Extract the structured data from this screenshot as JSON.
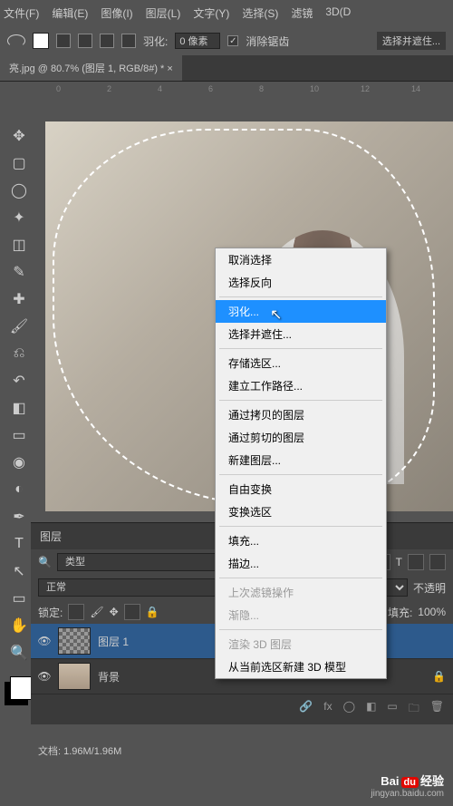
{
  "menubar": [
    "文件(F)",
    "编辑(E)",
    "图像(I)",
    "图层(L)",
    "文字(Y)",
    "选择(S)",
    "滤镜",
    "3D(D"
  ],
  "options": {
    "feather_label": "羽化:",
    "feather_value": "0 像素",
    "antialias": "消除锯齿",
    "selmask": "选择并遮住..."
  },
  "doc": {
    "tab": "亮.jpg @ 80.7% (图层 1, RGB/8#) *"
  },
  "ruler": [
    "0",
    "2",
    "4",
    "6",
    "8",
    "10",
    "12",
    "14"
  ],
  "tools": {
    "move": "✥",
    "marquee": "▢",
    "lasso": "◯",
    "wand": "✦",
    "crop": "◫",
    "eyedrop": "✎",
    "heal": "✚",
    "brush": "🖌",
    "stamp": "⎌",
    "history": "↶",
    "eraser": "◧",
    "gradient": "▭",
    "blur": "◉",
    "dodge": "◐",
    "pen": "✒",
    "type": "T",
    "path": "↖",
    "shape": "▭",
    "hand": "✋",
    "zoom": "🔍"
  },
  "context": {
    "items": [
      {
        "label": "取消选择",
        "enabled": true
      },
      {
        "label": "选择反向",
        "enabled": true
      },
      {
        "sep": true
      },
      {
        "label": "羽化...",
        "enabled": true,
        "hl": true
      },
      {
        "label": "选择并遮住...",
        "enabled": true
      },
      {
        "sep": true
      },
      {
        "label": "存储选区...",
        "enabled": true
      },
      {
        "label": "建立工作路径...",
        "enabled": true
      },
      {
        "sep": true
      },
      {
        "label": "通过拷贝的图层",
        "enabled": true
      },
      {
        "label": "通过剪切的图层",
        "enabled": true
      },
      {
        "label": "新建图层...",
        "enabled": true
      },
      {
        "sep": true
      },
      {
        "label": "自由变换",
        "enabled": true
      },
      {
        "label": "变换选区",
        "enabled": true
      },
      {
        "sep": true
      },
      {
        "label": "填充...",
        "enabled": true
      },
      {
        "label": "描边...",
        "enabled": true
      },
      {
        "sep": true
      },
      {
        "label": "上次滤镜操作",
        "enabled": false
      },
      {
        "label": "渐隐...",
        "enabled": false
      },
      {
        "sep": true
      },
      {
        "label": "渲染 3D 图层",
        "enabled": false
      },
      {
        "label": "从当前选区新建 3D 模型",
        "enabled": true
      }
    ]
  },
  "layers": {
    "title": "图层",
    "filter": "类型",
    "filter_placeholder": "🔍",
    "blend": "正常",
    "opacity_label": "不透明",
    "lock_label": "锁定:",
    "fill_label": "填充:",
    "fill_value": "100%",
    "items": [
      {
        "name": "图层 1",
        "active": true,
        "locked": false
      },
      {
        "name": "背景",
        "active": false,
        "locked": true
      }
    ],
    "foot": [
      "🔗",
      "fx",
      "◯",
      "◧",
      "▭",
      "🗀",
      "🗑"
    ]
  },
  "status": "文档: 1.96M/1.96M",
  "watermark": {
    "brand": "Bai",
    "du": "du",
    "suffix": "经验",
    "sub": "jingyan.baidu.com"
  }
}
